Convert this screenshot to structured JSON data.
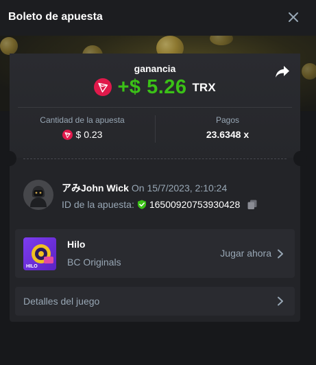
{
  "header": {
    "title": "Boleto de apuesta"
  },
  "win": {
    "label": "ganancia",
    "amount": "+$ 5.26",
    "currency": "TRX"
  },
  "stats": {
    "bet_amount_label": "Cantidad de la apuesta",
    "bet_amount_value": "$ 0.23",
    "payout_label": "Pagos",
    "payout_value": "23.6348 x"
  },
  "user": {
    "name": "アみJohn Wick",
    "date": "On 15/7/2023, 2:10:24",
    "bet_id_label": "ID de la apuesta:",
    "bet_id": "16500920753930428"
  },
  "game": {
    "name": "Hilo",
    "provider": "BC Originals",
    "play_label": "Jugar ahora",
    "thumb_text": "HILO"
  },
  "details": {
    "label": "Detalles del juego"
  },
  "colors": {
    "win_green": "#3bc117",
    "tron_red": "#e0194b",
    "muted": "#98a7b5",
    "accent_purple": "#7d3cf0"
  },
  "icons": [
    "close-icon",
    "tron-icon",
    "share-icon",
    "shield-check-icon",
    "copy-icon",
    "chevron-right-icon"
  ]
}
